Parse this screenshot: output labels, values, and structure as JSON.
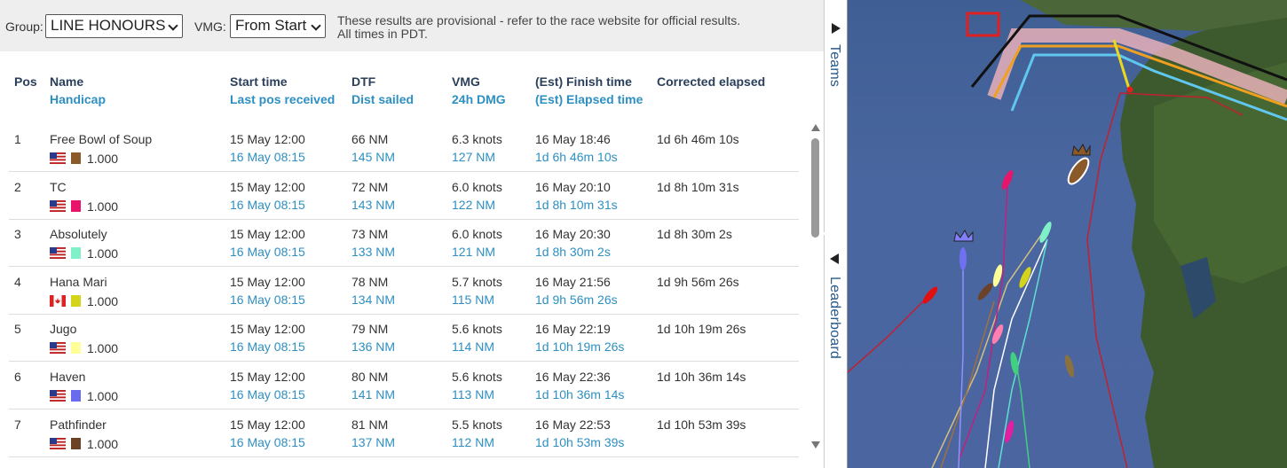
{
  "controls": {
    "group_label": "Group:",
    "group_value": "LINE HONOURS",
    "vmg_label": "VMG:",
    "vmg_value": "From Start",
    "note_line1": "These results are provisional - refer to the race website for official results.",
    "note_line2": "All times in PDT."
  },
  "headers": {
    "pos": "Pos",
    "name": "Name",
    "handicap": "Handicap",
    "start_time": "Start time",
    "last_pos": "Last pos received",
    "dtf": "DTF",
    "dist_sailed": "Dist sailed",
    "vmg": "VMG",
    "dmg": "24h DMG",
    "finish": "(Est) Finish time",
    "elapsed": "(Est) Elapsed time",
    "corrected": "Corrected elapsed"
  },
  "rows": [
    {
      "pos": "1",
      "name": "Free Bowl of Soup",
      "flag": "us",
      "color": "#8b5a2b",
      "handicap": "1.000",
      "start": "15 May 12:00",
      "last": "16 May 08:15",
      "dtf": "66 NM",
      "sailed": "145 NM",
      "vmg": "6.3 knots",
      "dmg": "127 NM",
      "finish": "16 May 18:46",
      "elapsed": "1d 6h 46m 10s",
      "corrected": "1d 6h 46m 10s"
    },
    {
      "pos": "2",
      "name": "TC",
      "flag": "us",
      "color": "#e8156b",
      "handicap": "1.000",
      "start": "15 May 12:00",
      "last": "16 May 08:15",
      "dtf": "72 NM",
      "sailed": "143 NM",
      "vmg": "6.0 knots",
      "dmg": "122 NM",
      "finish": "16 May 20:10",
      "elapsed": "1d 8h 10m 31s",
      "corrected": "1d 8h 10m 31s"
    },
    {
      "pos": "3",
      "name": "Absolutely",
      "flag": "us",
      "color": "#7ff0c8",
      "handicap": "1.000",
      "start": "15 May 12:00",
      "last": "16 May 08:15",
      "dtf": "73 NM",
      "sailed": "133 NM",
      "vmg": "6.0 knots",
      "dmg": "121 NM",
      "finish": "16 May 20:30",
      "elapsed": "1d 8h 30m 2s",
      "corrected": "1d 8h 30m 2s"
    },
    {
      "pos": "4",
      "name": "Hana Mari",
      "flag": "ca",
      "color": "#d4d41a",
      "handicap": "1.000",
      "start": "15 May 12:00",
      "last": "16 May 08:15",
      "dtf": "78 NM",
      "sailed": "134 NM",
      "vmg": "5.7 knots",
      "dmg": "115 NM",
      "finish": "16 May 21:56",
      "elapsed": "1d 9h 56m 26s",
      "corrected": "1d 9h 56m 26s"
    },
    {
      "pos": "5",
      "name": "Jugo",
      "flag": "us",
      "color": "#ffff99",
      "handicap": "1.000",
      "start": "15 May 12:00",
      "last": "16 May 08:15",
      "dtf": "79 NM",
      "sailed": "136 NM",
      "vmg": "5.6 knots",
      "dmg": "114 NM",
      "finish": "16 May 22:19",
      "elapsed": "1d 10h 19m 26s",
      "corrected": "1d 10h 19m 26s"
    },
    {
      "pos": "6",
      "name": "Haven",
      "flag": "us",
      "color": "#6b6bf0",
      "handicap": "1.000",
      "start": "15 May 12:00",
      "last": "16 May 08:15",
      "dtf": "80 NM",
      "sailed": "141 NM",
      "vmg": "5.6 knots",
      "dmg": "113 NM",
      "finish": "16 May 22:36",
      "elapsed": "1d 10h 36m 14s",
      "corrected": "1d 10h 36m 14s"
    },
    {
      "pos": "7",
      "name": "Pathfinder",
      "flag": "us",
      "color": "#6b4226",
      "handicap": "1.000",
      "start": "15 May 12:00",
      "last": "16 May 08:15",
      "dtf": "81 NM",
      "sailed": "137 NM",
      "vmg": "5.5 knots",
      "dmg": "112 NM",
      "finish": "16 May 22:53",
      "elapsed": "1d 10h 53m 39s",
      "corrected": "1d 10h 53m 39s"
    }
  ],
  "tabs": {
    "teams": "Teams",
    "leaderboard": "Leaderboard"
  }
}
